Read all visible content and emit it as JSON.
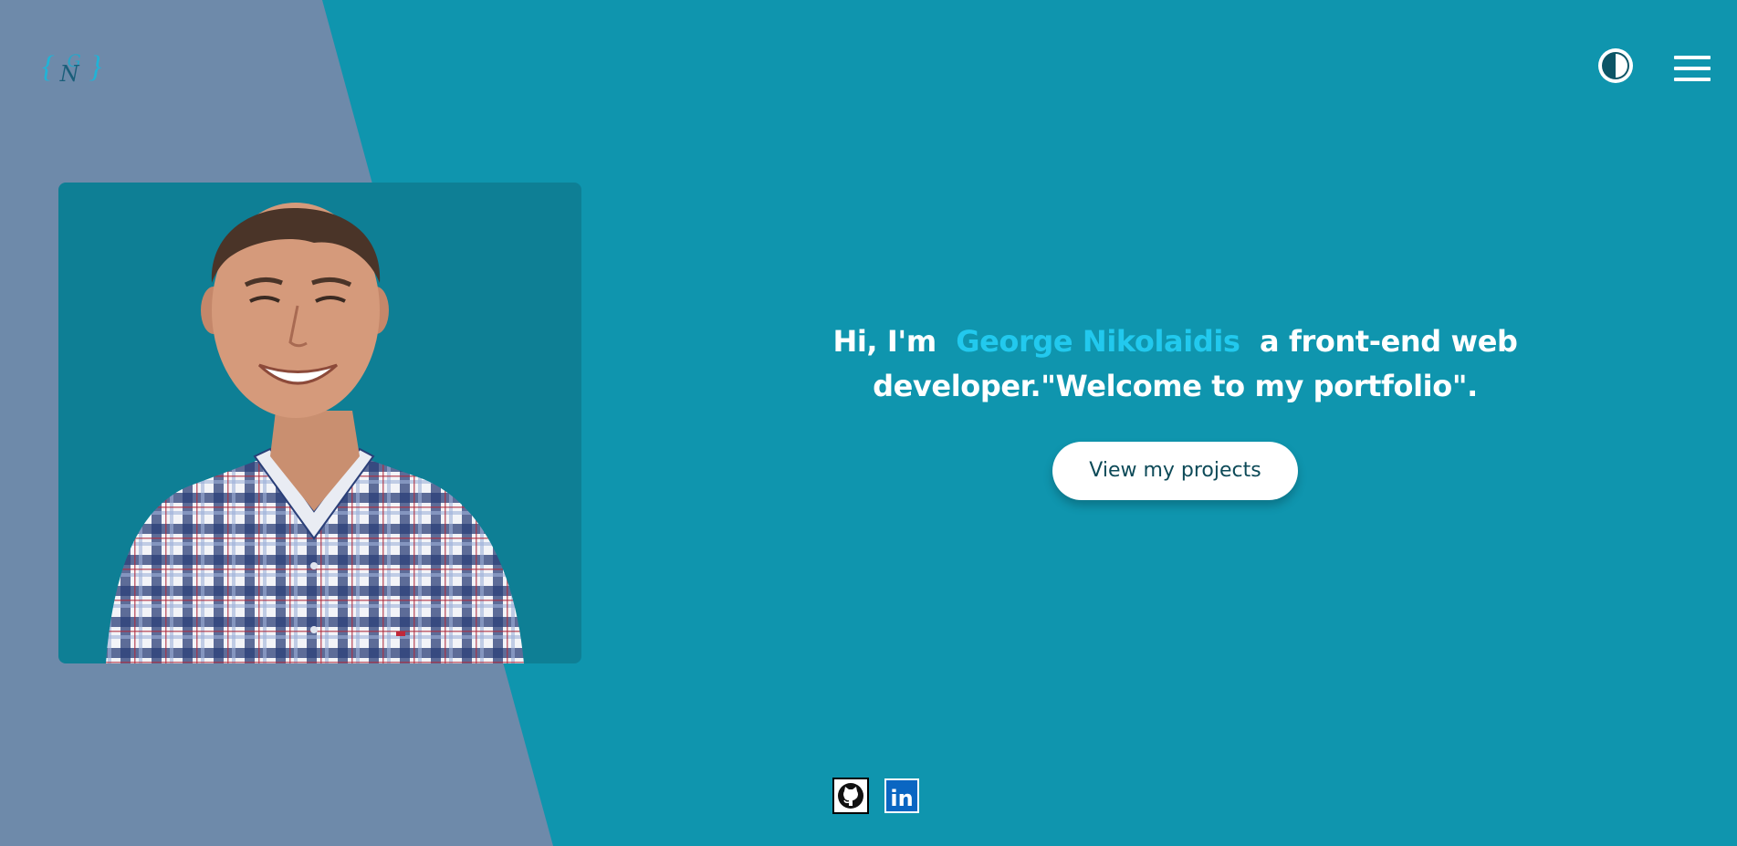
{
  "logo": {
    "left_brace": "{",
    "letters_top": "G",
    "letters_bottom": "N",
    "right_brace": "}"
  },
  "header": {
    "theme_toggle_icon": "contrast-icon",
    "menu_icon": "hamburger-menu-icon"
  },
  "hero": {
    "greeting": "Hi, I'm",
    "name": "George Nikolaidis",
    "tagline": "a front-end web developer.\"Welcome to my portfolio\".",
    "cta_label": "View my projects"
  },
  "photo": {
    "alt": "George Nikolaidis"
  },
  "socials": [
    {
      "icon": "github-icon"
    },
    {
      "icon": "linkedin-icon",
      "text": "in"
    }
  ],
  "colors": {
    "background": "#0f95ae",
    "diagonal_panel": "#6e8aaa",
    "accent_name": "#22c9ee",
    "photo_card": "#0e7f95",
    "button_bg": "#ffffff",
    "button_text": "#0d4a58",
    "linkedin": "#0a66c2"
  }
}
